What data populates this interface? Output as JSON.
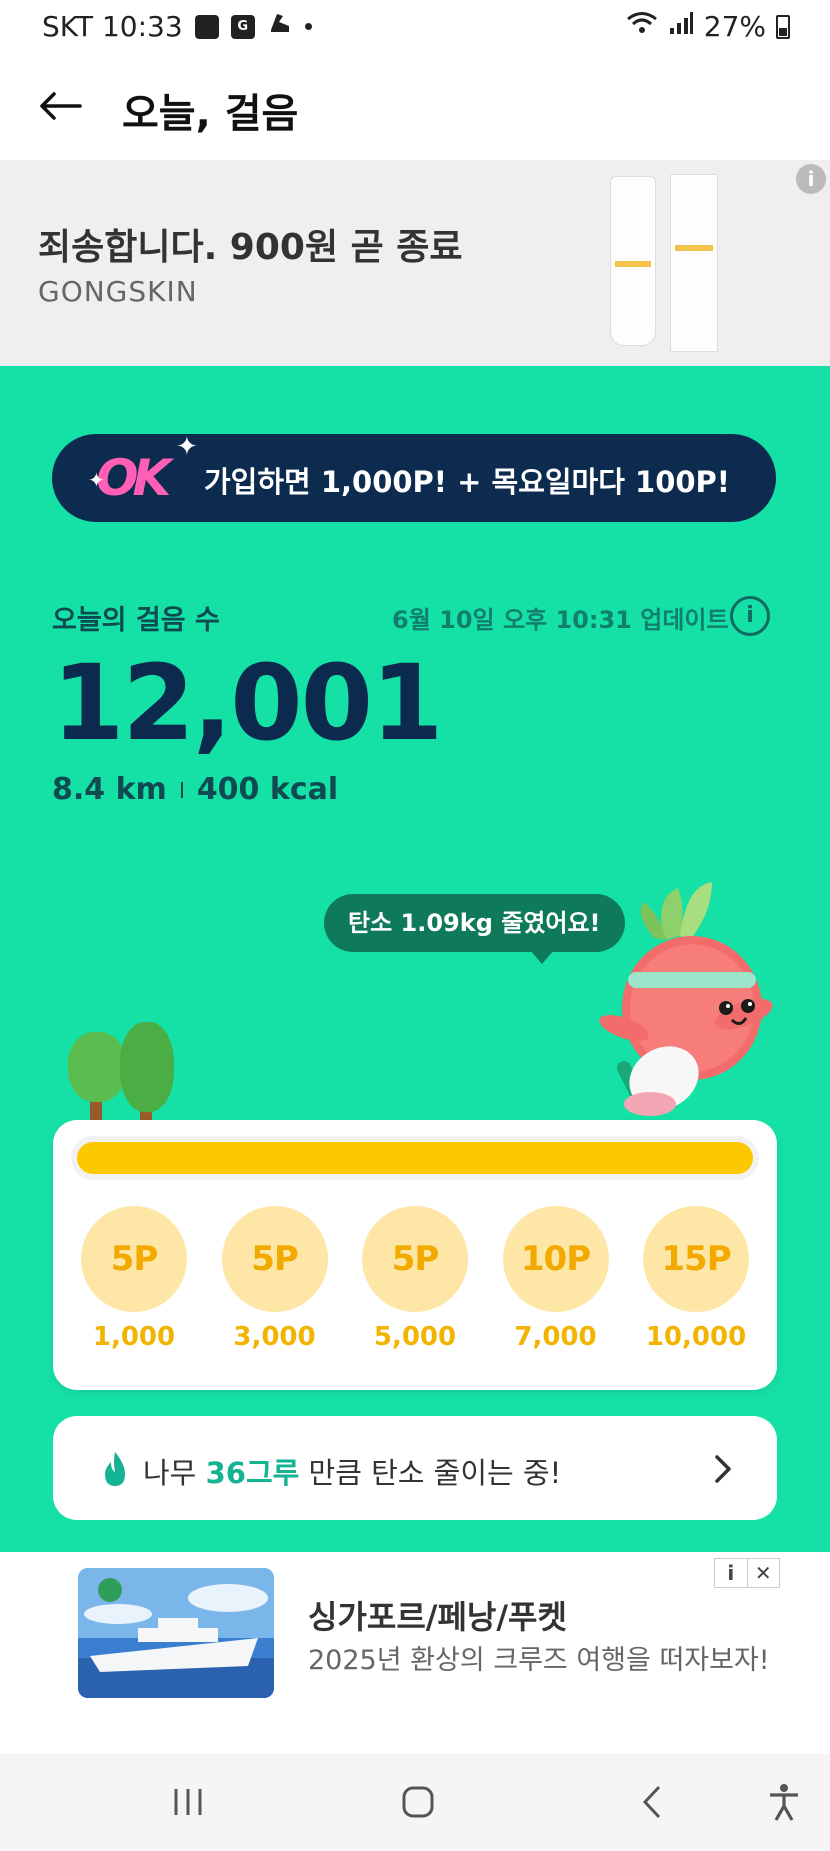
{
  "status_bar": {
    "carrier_time": "SKT 10:33",
    "battery": "27%"
  },
  "header": {
    "title": "오늘, 걸음"
  },
  "top_ad": {
    "headline": "죄송합니다. 900원 곧 종료",
    "brand": "GONGSKIN",
    "info": "i"
  },
  "promo": {
    "logo": "OK",
    "text": "가입하면 1,000P! + 목요일마다 100P!"
  },
  "steps": {
    "label": "오늘의 걸음 수",
    "updated": "6월 10일 오후 10:31 업데이트",
    "info": "i",
    "count": "12,001",
    "distance": "8.4 km",
    "calories": "400 kcal"
  },
  "carbon_bubble": "탄소 1.09kg 줄였어요!",
  "progress": {
    "fill_fraction": 1.0,
    "milestones": [
      {
        "points": "5P",
        "steps": "1,000"
      },
      {
        "points": "5P",
        "steps": "3,000"
      },
      {
        "points": "5P",
        "steps": "5,000"
      },
      {
        "points": "10P",
        "steps": "7,000"
      },
      {
        "points": "15P",
        "steps": "10,000"
      }
    ]
  },
  "tree_card": {
    "prefix": "나무 ",
    "highlight": "36그루",
    "suffix": " 만큼 탄소 줄이는 중!"
  },
  "bottom_ad": {
    "title": "싱가포르/페낭/푸켓",
    "subtitle": "2025년 환상의 크루즈 여행을 떠자보자!",
    "info": "i",
    "close": "✕"
  },
  "colors": {
    "background_green": "#15e1a6",
    "navy": "#0c2a4d",
    "gold": "#fcc800"
  }
}
